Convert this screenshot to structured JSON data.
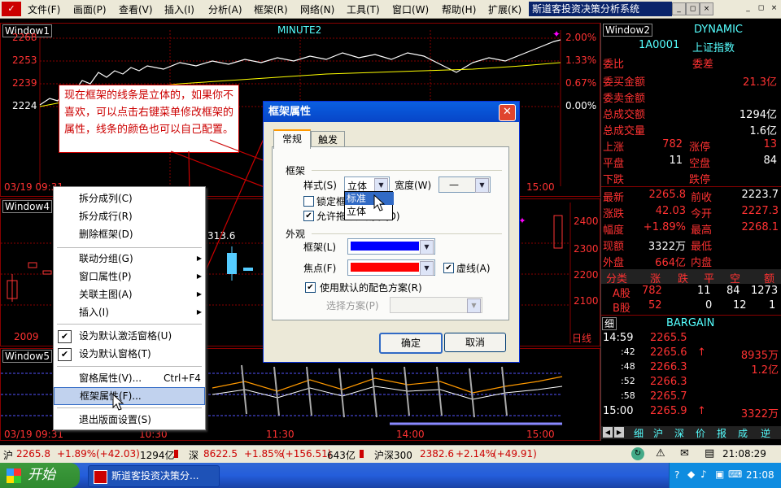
{
  "menubar": {
    "logo": "✓",
    "items": [
      "文件(F)",
      "画面(P)",
      "查看(V)",
      "插入(I)",
      "分析(A)",
      "框架(R)",
      "网络(N)",
      "工具(T)",
      "窗口(W)",
      "帮助(H)",
      "扩展(K)"
    ],
    "app_title": "斯道客投资决策分析系统",
    "win_buttons": [
      "_",
      "◻",
      "×"
    ],
    "mdi_buttons": [
      "_",
      "◻",
      "×"
    ]
  },
  "window1": {
    "label": "Window1",
    "title": "MINUTE2",
    "left_axis": [
      "2268",
      "2253",
      "2239",
      "2224"
    ],
    "right_axis": [
      "2.00%",
      "1.33%",
      "0.67%",
      "0.00%"
    ],
    "date_label": "03/19 09:31",
    "time_label": "15:00"
  },
  "window4": {
    "label": "Window4",
    "value_label": "313.6",
    "right_axis": [
      "2400",
      "2300",
      "2200",
      "2100"
    ],
    "year_label": "2009",
    "period_label": "日线"
  },
  "window5": {
    "label": "Window5",
    "times": [
      "03/19 09:31",
      "10:30",
      "11:30",
      "14:00",
      "15:00"
    ]
  },
  "right_panel": {
    "window_label": "Window2",
    "title": "DYNAMIC",
    "code": "1A0001",
    "name": "上证指数",
    "weibi_label": "委比",
    "weicha_label": "委差",
    "rows_top": [
      {
        "label": "委买金额",
        "value": "21.3亿"
      },
      {
        "label": "委卖金额",
        "value": ""
      },
      {
        "label": "总成交额",
        "value": "1294亿"
      },
      {
        "label": "总成交量",
        "value": "1.6亿"
      }
    ],
    "updown": [
      {
        "l1": "上涨",
        "v1": "782",
        "l2": "涨停",
        "v2": "13"
      },
      {
        "l1": "平盘",
        "v1": "11",
        "l2": "空盘",
        "v2": "84"
      },
      {
        "l1": "下跌",
        "v1": "",
        "l2": "跌停",
        "v2": ""
      }
    ],
    "quotes": [
      {
        "l1": "最新",
        "v1": "2265.8",
        "l2": "前收",
        "v2": "2223.7"
      },
      {
        "l1": "涨跌",
        "v1": "42.03",
        "l2": "今开",
        "v2": "2227.3"
      },
      {
        "l1": "幅度",
        "v1": "+1.89%",
        "l2": "最高",
        "v2": "2268.1"
      },
      {
        "l1": "现额",
        "v1": "3322万",
        "l2": "最低",
        "v2": ""
      },
      {
        "l1": "外盘",
        "v1": "664亿",
        "l2": "内盘",
        "v2": ""
      }
    ],
    "class_headers": [
      "分类",
      "涨",
      "跌",
      "平",
      "空",
      "额"
    ],
    "class_rows": [
      {
        "name": "A股",
        "up": "782",
        "down": "11",
        "flat": "84",
        "empty": "1273"
      },
      {
        "name": "B股",
        "up": "52",
        "down": "0",
        "flat": "12",
        "empty": "1"
      }
    ],
    "bargain_label": "细",
    "bargain_title": "BARGAIN",
    "trades": [
      {
        "time": "14:59",
        "price": "2265.5",
        "arrow": "",
        "vol": ""
      },
      {
        "time": ":42",
        "price": "2265.6",
        "arrow": "↑",
        "vol": "8935万"
      },
      {
        "time": ":48",
        "price": "2266.3",
        "arrow": "",
        "vol": "1.2亿"
      },
      {
        "time": ":52",
        "price": "2266.3",
        "arrow": "",
        "vol": ""
      },
      {
        "time": ":58",
        "price": "2265.7",
        "arrow": "",
        "vol": ""
      },
      {
        "time": "15:00",
        "price": "2265.9",
        "arrow": "↑",
        "vol": "3322万"
      }
    ],
    "bottom_tabs": [
      "细",
      "沪",
      "深",
      "价",
      "报",
      "成",
      "逆"
    ]
  },
  "annotation": {
    "text": "现在框架的线条是立体的，如果你不喜欢，可以点击右键菜单修改框架的属性，线条的颜色也可以自己配置。"
  },
  "context_menu": {
    "items": [
      {
        "label": "拆分成列(C)",
        "shortcut": "",
        "submenu": false,
        "checked": false
      },
      {
        "label": "拆分成行(R)",
        "shortcut": "",
        "submenu": false,
        "checked": false
      },
      {
        "label": "删除框架(D)",
        "shortcut": "",
        "submenu": false,
        "checked": false
      },
      {
        "label": "联动分组(G)",
        "shortcut": "",
        "submenu": true,
        "checked": false
      },
      {
        "label": "窗口属性(P)",
        "shortcut": "",
        "submenu": true,
        "checked": false
      },
      {
        "label": "关联主图(A)",
        "shortcut": "",
        "submenu": true,
        "checked": false
      },
      {
        "label": "插入(I)",
        "shortcut": "",
        "submenu": true,
        "checked": false
      },
      {
        "label": "设为默认激活窗格(U)",
        "shortcut": "",
        "submenu": false,
        "checked": true
      },
      {
        "label": "设为默认窗格(T)",
        "shortcut": "",
        "submenu": false,
        "checked": true
      },
      {
        "label": "窗格属性(V)...",
        "shortcut": "Ctrl+F4",
        "submenu": false,
        "checked": false
      },
      {
        "label": "框架属性(F)...",
        "shortcut": "",
        "submenu": false,
        "checked": false
      },
      {
        "label": "退出版面设置(S)",
        "shortcut": "",
        "submenu": false,
        "checked": false
      }
    ]
  },
  "dialog": {
    "title": "框架属性",
    "tabs": [
      "常规",
      "触发"
    ],
    "frame_group": "框架",
    "style_label": "样式(S)",
    "style_value": "立体",
    "width_label": "宽度(W)",
    "width_value": "—",
    "style_options": [
      "标准",
      "立体"
    ],
    "lock_label": "锁定框",
    "allow_label": "允许拖动分割条(D)",
    "appearance_group": "外观",
    "frame_color_label": "框架(L)",
    "frame_color": "#0000ff",
    "focus_color_label": "焦点(F)",
    "focus_color": "#ff0000",
    "dashed_label": "虚线(A)",
    "default_scheme_label": "使用默认的配色方案(R)",
    "choose_scheme_label": "选择方案(P)",
    "ok": "确定",
    "cancel": "取消"
  },
  "statusbar": {
    "sh": "沪",
    "sh_price": "2265.8",
    "sh_pct": "+1.89%",
    "sh_chg": "(+42.03)",
    "sh_amt": "1294亿",
    "sz": "深",
    "sz_price": "8622.5",
    "sz_pct": "+1.85%",
    "sz_chg": "(+156.51)",
    "sz_amt": "643亿",
    "hs": "沪深300",
    "hs_price": "2382.6",
    "hs_pct": "+2.14%",
    "hs_chg": "(+49.91)",
    "clock": "21:08:29"
  },
  "taskbar": {
    "start": "开始",
    "task": "斯道客投资决策分...",
    "time": "21:08"
  }
}
